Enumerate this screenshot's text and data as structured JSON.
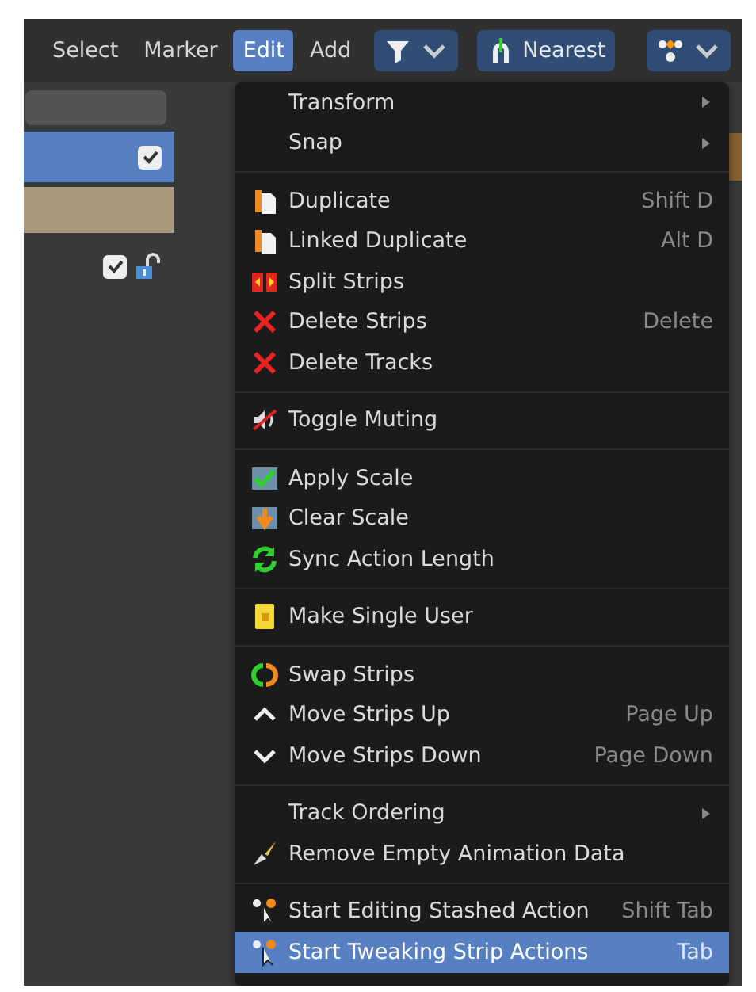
{
  "header": {
    "menus": [
      {
        "label": "Select",
        "selected": false
      },
      {
        "label": "Marker",
        "selected": false
      },
      {
        "label": "Edit",
        "selected": true
      },
      {
        "label": "Add",
        "selected": false
      }
    ],
    "snap_button": {
      "label": "Nearest"
    }
  },
  "left_panel": {
    "rows": [
      {
        "kind": "track",
        "selected": true,
        "checked": true
      },
      {
        "kind": "action"
      },
      {
        "kind": "object",
        "selected": false,
        "checked": true,
        "locked": false
      }
    ]
  },
  "edit_menu": {
    "sections": [
      {
        "items": [
          {
            "label": "Transform",
            "submenu": true,
            "selected": false
          },
          {
            "label": "Snap",
            "submenu": true,
            "selected": false
          }
        ]
      },
      {
        "items": [
          {
            "label": "Duplicate",
            "shortcut": "Shift D",
            "selected": false
          },
          {
            "label": "Linked Duplicate",
            "shortcut": "Alt D",
            "selected": false
          },
          {
            "label": "Split Strips",
            "selected": false
          },
          {
            "label": "Delete Strips",
            "shortcut": "Delete",
            "selected": false
          },
          {
            "label": "Delete Tracks",
            "selected": false
          }
        ]
      },
      {
        "items": [
          {
            "label": "Toggle Muting",
            "selected": false
          }
        ]
      },
      {
        "items": [
          {
            "label": "Apply Scale",
            "selected": false
          },
          {
            "label": "Clear Scale",
            "selected": false
          },
          {
            "label": "Sync Action Length",
            "selected": false
          }
        ]
      },
      {
        "items": [
          {
            "label": "Make Single User",
            "selected": false
          }
        ]
      },
      {
        "items": [
          {
            "label": "Swap Strips",
            "selected": false
          },
          {
            "label": "Move Strips Up",
            "shortcut": "Page Up",
            "selected": false
          },
          {
            "label": "Move Strips Down",
            "shortcut": "Page Down",
            "selected": false
          }
        ]
      },
      {
        "items": [
          {
            "label": "Track Ordering",
            "submenu": true,
            "selected": false
          },
          {
            "label": "Remove Empty Animation Data",
            "selected": false
          }
        ]
      },
      {
        "items": [
          {
            "label": "Start Editing Stashed Action",
            "shortcut": "Shift Tab",
            "selected": false
          },
          {
            "label": "Start Tweaking Strip Actions",
            "shortcut": "Tab",
            "selected": true
          }
        ]
      }
    ]
  }
}
